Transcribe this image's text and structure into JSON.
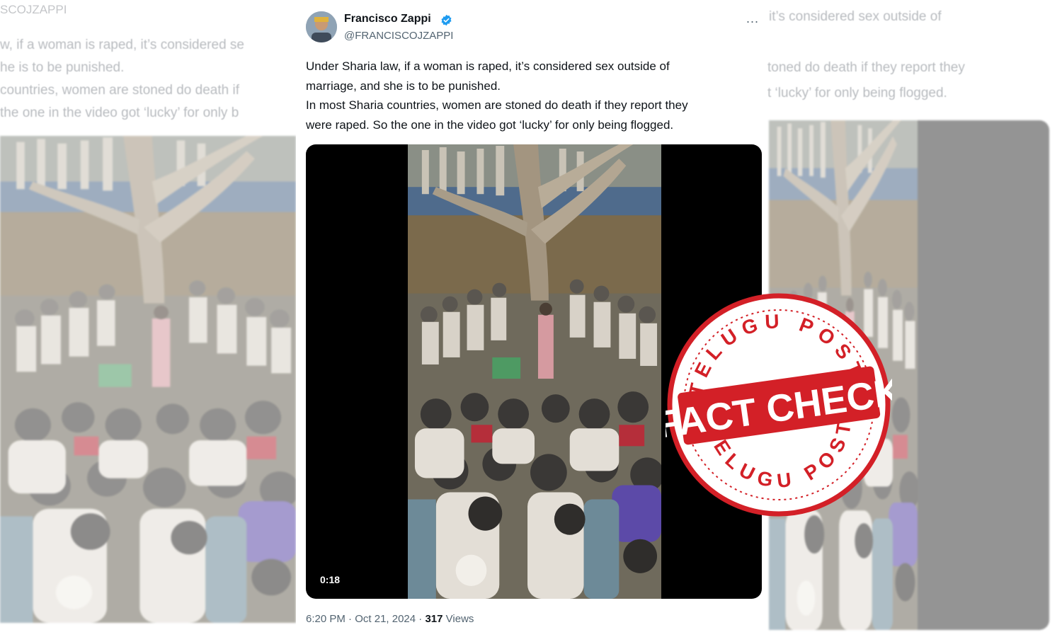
{
  "tweet": {
    "display_name": "Francisco Zappi",
    "handle": "@FRANCISCOJZAPPI",
    "more_label": "...",
    "lines": [
      "Under Sharia law, if a woman is raped, it’s considered sex outside of",
      "marriage, and she is to be punished.",
      "In most Sharia countries, women are stoned do death if they report they",
      "were raped. So the one in the video got ‘lucky’ for only being flogged."
    ],
    "video_duration": "0:18",
    "time": "6:20 PM",
    "date": "Oct 21, 2024",
    "views_count": "317",
    "views_label": "Views",
    "verified_badge": "verified-icon"
  },
  "left_faded": {
    "handle": "SCOJZAPPI",
    "lines": [
      "w, if a woman is raped, it’s considered se",
      "he is to be punished.",
      "countries, women are stoned do death if",
      "the one in the video got ‘lucky’ for only b"
    ]
  },
  "right_faded": {
    "more_label": "...",
    "lines": [
      "it’s considered sex outside of",
      "toned do death if they report they",
      "t ‘lucky’ for only being flogged."
    ]
  },
  "stamp": {
    "top_text": "TELUGU POST",
    "bottom_text": "TELUGU POST",
    "center_text": "FACT CHECK",
    "color": "#d32027"
  },
  "colors": {
    "text_primary": "#0f1419",
    "text_secondary": "#536471",
    "verified_blue": "#1d9bf0"
  }
}
